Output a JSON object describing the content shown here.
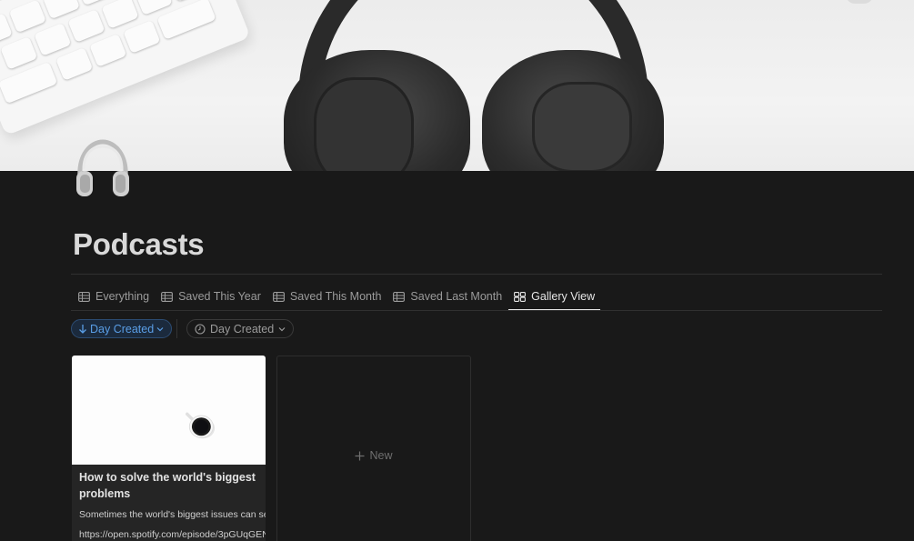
{
  "page": {
    "title": "Podcasts",
    "icon": "headphones-icon"
  },
  "tabs": [
    {
      "label": "Everything",
      "icon": "table-icon",
      "active": false
    },
    {
      "label": "Saved This Year",
      "icon": "table-icon",
      "active": false
    },
    {
      "label": "Saved This Month",
      "icon": "table-icon",
      "active": false
    },
    {
      "label": "Saved Last Month",
      "icon": "table-icon",
      "active": false
    },
    {
      "label": "Gallery View",
      "icon": "gallery-icon",
      "active": true
    }
  ],
  "filters": {
    "sort": {
      "label": "Day Created",
      "icon": "arrow-down-icon",
      "color": "#5a9ee6"
    },
    "filter": {
      "label": "Day Created",
      "icon": "clock-icon"
    }
  },
  "cards": [
    {
      "title": "How to solve the world's biggest problems",
      "description": "Sometimes the world's biggest issues can se",
      "url": "https://open.spotify.com/episode/3pGUqGEN"
    }
  ],
  "new_card": {
    "label": "New",
    "icon": "plus-icon"
  }
}
